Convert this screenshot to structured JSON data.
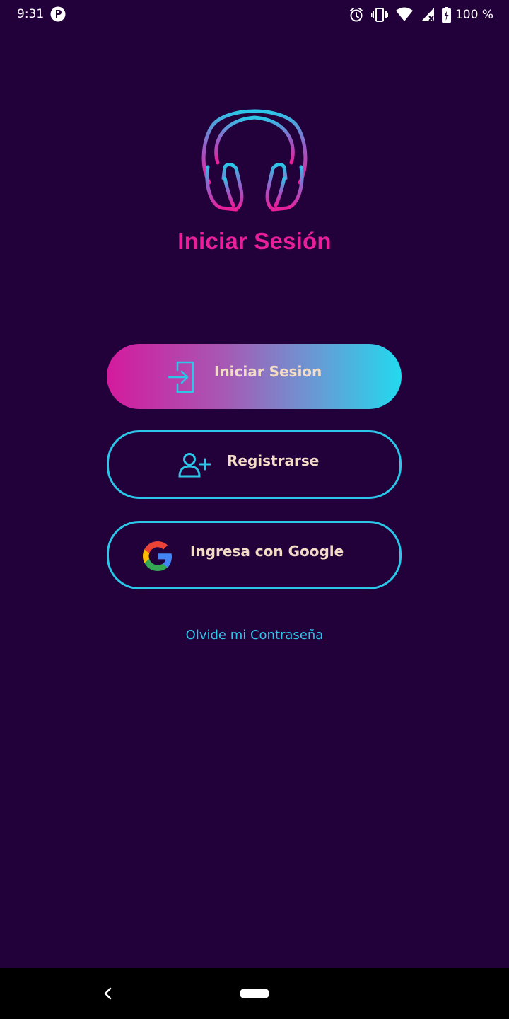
{
  "status_bar": {
    "time": "9:31",
    "battery_percent": "100 %",
    "icons": [
      "app-notification-icon",
      "alarm-icon",
      "vibrate-icon",
      "wifi-icon",
      "cell-signal-icon",
      "battery-charging-icon"
    ]
  },
  "header": {
    "logo": "headphones-logo-icon",
    "title": "Iniciar Sesión"
  },
  "actions": {
    "login_label": "Iniciar Sesion",
    "login_icon": "login-icon",
    "register_label": "Registrarse",
    "register_icon": "add-user-icon",
    "google_label": "Ingresa con Google",
    "google_icon": "google-icon",
    "forgot_password_link": "Olvide mi Contraseña"
  },
  "navigation": {
    "back": "back-icon",
    "home": "home-pill"
  },
  "colors": {
    "background": "#22013a",
    "title": "#e91e9a",
    "accent_cyan": "#2bc6e8",
    "button_text": "#f3dcc6",
    "gradient_start": "#d41a9e",
    "gradient_end": "#22d9ee"
  }
}
